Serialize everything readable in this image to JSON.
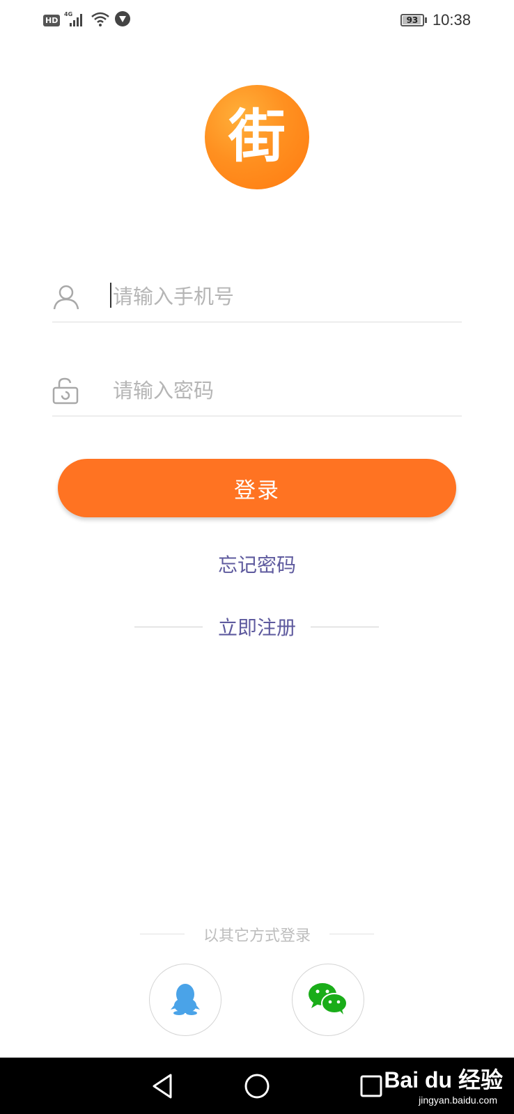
{
  "status_bar": {
    "hd_badge": "HD",
    "network": "4G",
    "battery_level": "93",
    "battery_fraction": 0.93,
    "time": "10:38",
    "icons": [
      "hd-icon",
      "signal-icon",
      "wifi-icon",
      "vpn-icon",
      "battery-icon"
    ]
  },
  "logo": {
    "text": "街",
    "colors": {
      "light": "#ffb03a",
      "dark": "#ff7a10"
    }
  },
  "form": {
    "phone": {
      "placeholder": "请输入手机号",
      "value": "",
      "icon": "user-icon"
    },
    "password": {
      "placeholder": "请输入密码",
      "value": "",
      "icon": "lock-icon"
    },
    "login_label": "登录",
    "forgot_label": "忘记密码",
    "register_label": "立即注册"
  },
  "other_login": {
    "label": "以其它方式登录",
    "providers": [
      {
        "name": "qq",
        "icon": "qq-icon",
        "color": "#4aa3e8"
      },
      {
        "name": "wechat",
        "icon": "wechat-icon",
        "color": "#1aad19"
      }
    ]
  },
  "nav": {
    "icons": [
      "back-icon",
      "home-icon",
      "recent-apps-icon"
    ]
  },
  "watermark": {
    "domain": "jingyan.baidu.com",
    "brand": "Bai du 经验"
  },
  "colors": {
    "accent": "#ff7322",
    "link": "#5e5a9e",
    "placeholder": "#b5b5b5"
  }
}
